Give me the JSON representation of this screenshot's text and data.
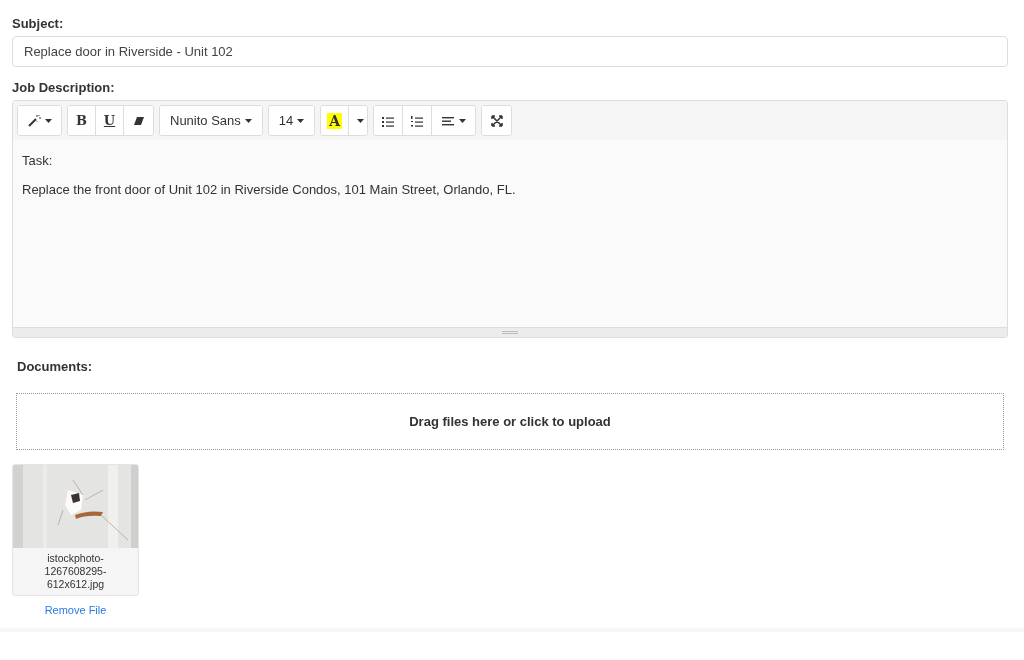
{
  "subject": {
    "label": "Subject:",
    "value": "Replace door in Riverside - Unit 102"
  },
  "description": {
    "label": "Job Description:",
    "toolbar": [
      [
        {
          "kind": "magic",
          "caret": true
        }
      ],
      [
        {
          "kind": "bold",
          "label": "B"
        },
        {
          "kind": "underline",
          "label": "U"
        },
        {
          "kind": "eraser"
        }
      ],
      [
        {
          "kind": "text",
          "label": "Nunito Sans",
          "caret": true
        }
      ],
      [
        {
          "kind": "text",
          "label": "14",
          "caret": true
        }
      ],
      [
        {
          "kind": "highlight",
          "label": "A",
          "color": "#ffff00"
        },
        {
          "kind": "caret"
        }
      ],
      [
        {
          "kind": "bullets"
        },
        {
          "kind": "numbers"
        },
        {
          "kind": "align",
          "caret": true
        }
      ],
      [
        {
          "kind": "expand"
        }
      ]
    ],
    "paragraphs": [
      "Task:",
      "Replace the front door of Unit 102 in Riverside Condos, 101 Main Street, Orlando, FL."
    ]
  },
  "documents": {
    "label": "Documents:",
    "dropzone": "Drag files here or click to upload",
    "files": [
      {
        "kind": "picture",
        "name": "istockphoto-1267608295-612x612.jpg",
        "remove": "Remove File"
      }
    ]
  }
}
